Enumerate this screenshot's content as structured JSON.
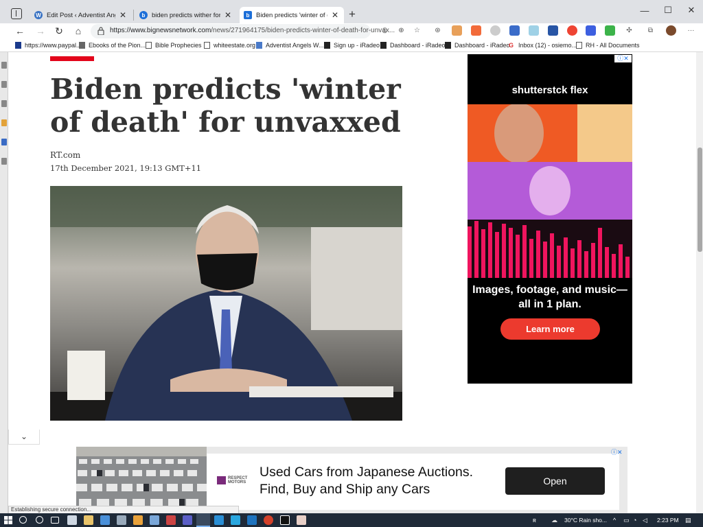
{
  "browser": {
    "tabs": [
      {
        "title": "Edit Post ‹ Adventist Angels Wat",
        "favicon_color": "#3a73c4",
        "active": false
      },
      {
        "title": "biden predicts wither for unvaxx",
        "favicon_color": "#1d6fd8",
        "active": false
      },
      {
        "title": "Biden predicts 'winter of death' f",
        "favicon_color": "#1d6fd8",
        "active": true
      }
    ],
    "url_host": "https://www.bignewsnetwork.com",
    "url_path": "/news/271964175/biden-predicts-winter-of-death-for-unvax...",
    "bookmarks": [
      "https://www.paypal....",
      "Ebooks of the Pion...",
      "Bible Prophecies",
      "whiteestate.org",
      "Adventist Angels W...",
      "Sign up - iRadeo",
      "Dashboard - iRadeo",
      "Dashboard - iRadeo",
      "Inbox (12) - osiemo...",
      "RH - All Documents"
    ]
  },
  "article": {
    "title": "Biden predicts 'winter of death' for unvaxxed",
    "source": "RT.com",
    "date": "17th December 2021, 19:13 GMT+11"
  },
  "ad_right": {
    "brand": "shutterstck flex",
    "headline": "Images, footage, and music—all in 1 plan.",
    "cta": "Learn more"
  },
  "ad_bottom": {
    "logo_line1": "RESPECT",
    "logo_line2": "MOTORS",
    "line1": "Used Cars from Japanese Auctions.",
    "line2": "Find, Buy and Ship any Cars",
    "cta": "Open"
  },
  "status_bar": "Establishing secure connection...",
  "taskbar": {
    "weather": "30°C  Rain sho...",
    "time": "2:23 PM"
  },
  "colors": {
    "accent_red": "#e3051b",
    "ad_cta_red": "#ec3a2e"
  }
}
